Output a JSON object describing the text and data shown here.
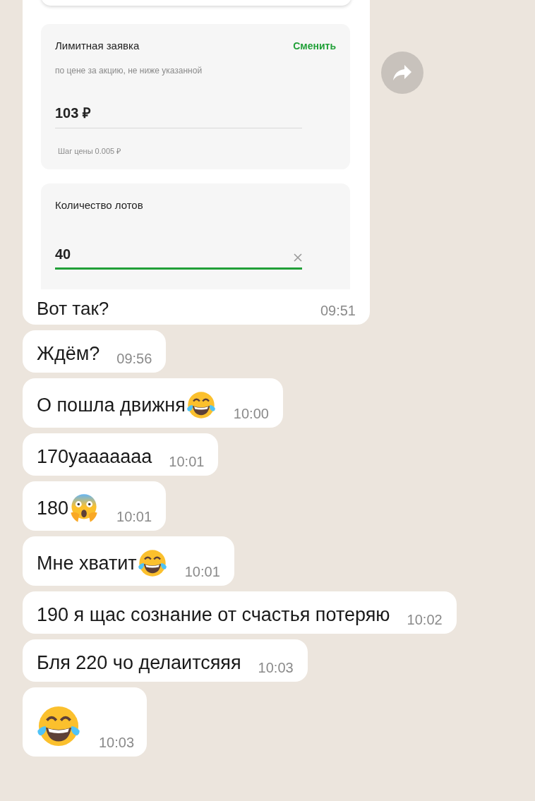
{
  "messages": [
    {
      "kind": "screenshot",
      "screenshot": {
        "order_card": {
          "title": "Лимитная заявка",
          "action": "Сменить",
          "subtitle": "по цене за акцию, не ниже указанной",
          "price": "103 ₽",
          "step": "Шаг цены 0.005 ₽"
        },
        "lots_card": {
          "title": "Количество лотов",
          "value": "40",
          "focused": true
        }
      },
      "text": "Вот так?",
      "time": "09:51",
      "forward": true
    },
    {
      "kind": "text",
      "text": "Ждём?",
      "time": "09:56"
    },
    {
      "kind": "text",
      "text": "О пошла движня",
      "emoji": {
        "kind": "laughing"
      },
      "time": "10:00"
    },
    {
      "kind": "text",
      "text": "170уааааааа",
      "time": "10:01"
    },
    {
      "kind": "text",
      "text": "180",
      "emoji": {
        "kind": "screaming"
      },
      "time": "10:01"
    },
    {
      "kind": "text",
      "text": "Мне хватит",
      "emoji": {
        "kind": "laughing"
      },
      "time": "10:01"
    },
    {
      "kind": "text",
      "text": "190 я щас сознание от счастья потеряю",
      "time": "10:02"
    },
    {
      "kind": "text",
      "text": "Бля 220 чо делаитсяяя",
      "time": "10:03"
    },
    {
      "kind": "emoji_only",
      "emoji": {
        "kind": "laughing"
      },
      "time": "10:03"
    }
  ]
}
